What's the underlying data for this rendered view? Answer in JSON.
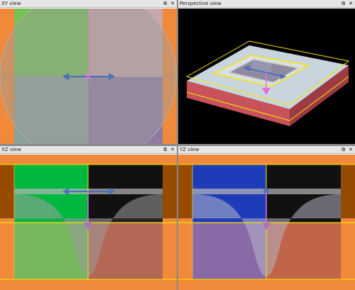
{
  "views": {
    "xy": {
      "title": "XY view"
    },
    "perspective": {
      "title": "Perspective view"
    },
    "xz": {
      "title": "XZ view"
    },
    "yz": {
      "title": "YZ view"
    }
  },
  "titlebar_icons": {
    "float": "⧉",
    "close": "✕"
  },
  "colors": {
    "orange": "#f08a3a",
    "dark_orange": "#964b00",
    "green": "#4fc22a",
    "blue": "#1f45c8",
    "pink": "#c9a6a9",
    "purple": "#8f7aa0",
    "yellow": "#f7e600",
    "handle_blue": "#4b6fb8",
    "marker_magenta": "#e070e0"
  }
}
